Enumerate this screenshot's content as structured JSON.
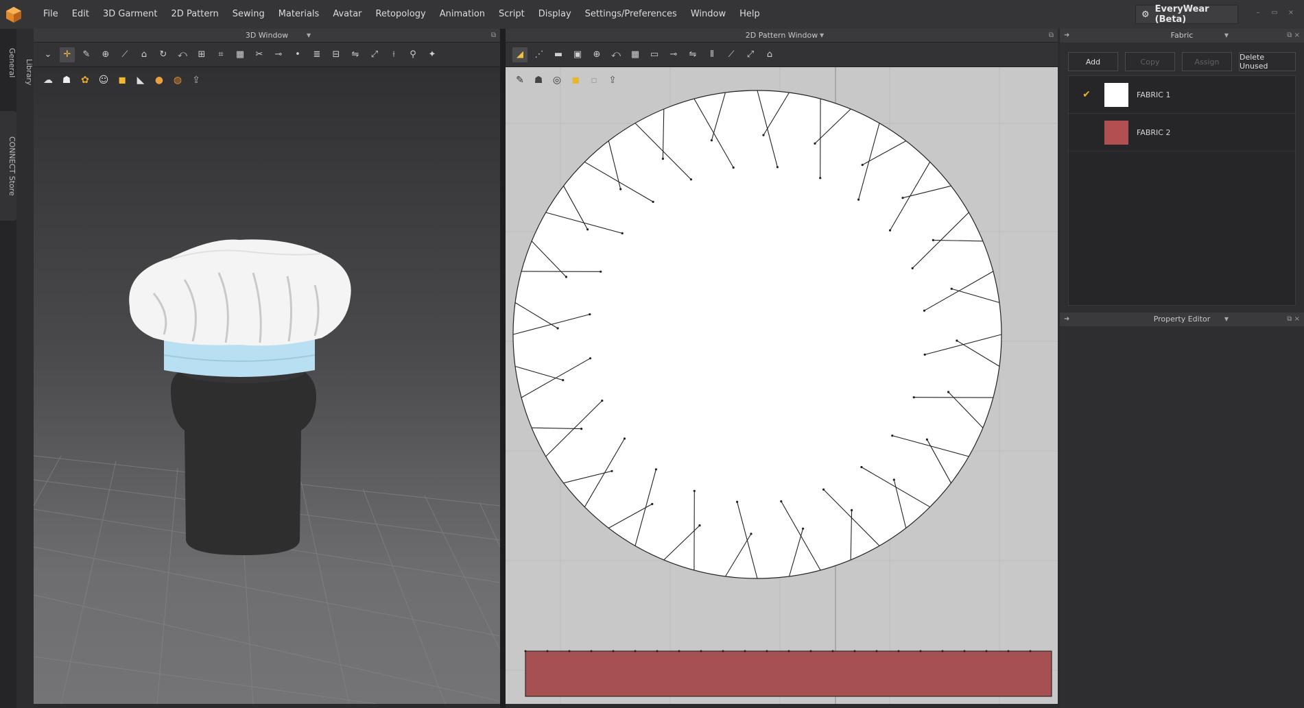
{
  "menubar": {
    "items": [
      "File",
      "Edit",
      "3D Garment",
      "2D Pattern",
      "Sewing",
      "Materials",
      "Avatar",
      "Retopology",
      "Animation",
      "Script",
      "Display",
      "Settings/Preferences",
      "Window",
      "Help"
    ],
    "product_switch": "EveryWear (Beta)",
    "window_controls": [
      "–",
      "▭",
      "×"
    ]
  },
  "left_tabs": {
    "general": "General",
    "connect": "CONNECT Store",
    "library": "Library"
  },
  "window3d": {
    "title": "3D Window",
    "toolbar_icons": [
      "select-icon",
      "move-icon",
      "brush-icon",
      "tack-icon",
      "pin-icon",
      "garment-icon",
      "rotate-icon",
      "fold-icon",
      "shirt-icon",
      "mesh-icon",
      "grid-icon",
      "cut-icon",
      "sew-icon",
      "point-icon",
      "layer-icon",
      "align-icon",
      "flip-icon",
      "measure-icon",
      "ruler-icon",
      "walk-icon",
      "extra-icon"
    ],
    "avatar_tools": [
      "hair-icon",
      "shirt-icon",
      "texture-icon",
      "avatar-icon",
      "fabric-icon",
      "shoe-icon",
      "skin-icon",
      "globe-icon",
      "export-icon"
    ]
  },
  "window2d": {
    "title": "2D Pattern Window",
    "toolbar_icons": [
      "edit-pattern-icon",
      "points-icon",
      "rectangle-icon",
      "frame-icon",
      "pin-icon",
      "fold-icon",
      "grid-icon",
      "segment-icon",
      "seam-icon",
      "sew-icon",
      "stripes-icon",
      "draw-icon",
      "measure-icon",
      "shirt-icon"
    ],
    "view_tools": [
      "brush-icon",
      "shirt-icon",
      "texture-icon",
      "fabric-icon",
      "shade-icon",
      "export-icon"
    ]
  },
  "fabric_panel": {
    "title": "Fabric",
    "buttons": [
      {
        "label": "Add",
        "enabled": true
      },
      {
        "label": "Copy",
        "enabled": false
      },
      {
        "label": "Assign",
        "enabled": false
      },
      {
        "label": "Delete Unused",
        "enabled": true
      }
    ],
    "fabrics": [
      {
        "name": "FABRIC 1",
        "color": "#ffffff",
        "selected": true
      },
      {
        "name": "FABRIC 2",
        "color": "#b24f51",
        "selected": false
      }
    ]
  },
  "property_editor": {
    "title": "Property Editor"
  },
  "colors": {
    "accent": "#e8b520",
    "fabric1": "#ffffff",
    "fabric2": "#b24f51",
    "band": "#b9e0f2",
    "avatar": "#2e2e2f"
  }
}
